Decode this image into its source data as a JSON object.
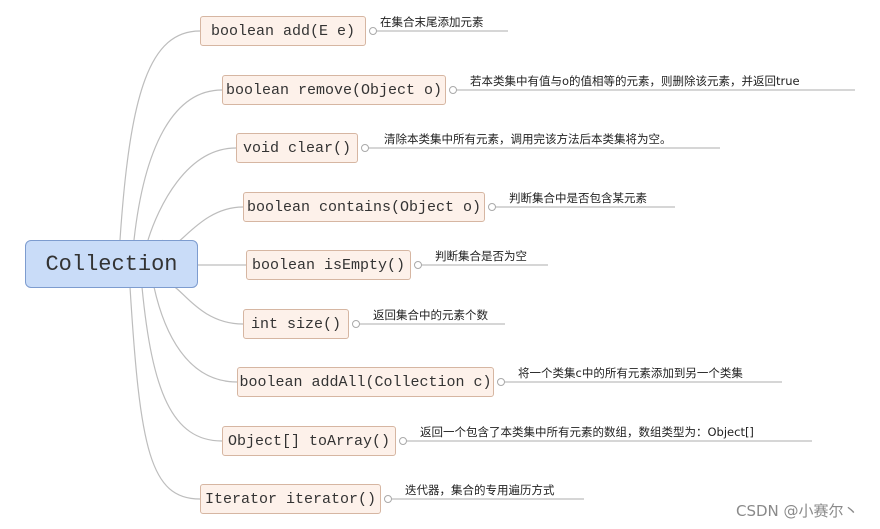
{
  "root": {
    "label": "Collection"
  },
  "methods": [
    {
      "signature": "boolean add(E e)",
      "description": "在集合末尾添加元素"
    },
    {
      "signature": "boolean remove(Object o)",
      "description": "若本类集中有值与o的值相等的元素，则删除该元素，并返回true"
    },
    {
      "signature": "void clear()",
      "description": "清除本类集中所有元素，调用完该方法后本类集将为空。"
    },
    {
      "signature": "boolean contains(Object o)",
      "description": "判断集合中是否包含某元素"
    },
    {
      "signature": "boolean isEmpty()",
      "description": "判断集合是否为空"
    },
    {
      "signature": "int size()",
      "description": "返回集合中的元素个数"
    },
    {
      "signature": "boolean addAll(Collection c)",
      "description": "将一个类集c中的所有元素添加到另一个类集"
    },
    {
      "signature": "Object[] toArray()",
      "description": "返回一个包含了本类集中所有元素的数组，数组类型为：Object[]"
    },
    {
      "signature": "Iterator iterator()",
      "description": "迭代器，集合的专用遍历方式"
    }
  ],
  "watermark": "CSDN @小赛尔丶",
  "colors": {
    "root_fill": "#c9dcf8",
    "root_border": "#7d9ccf",
    "node_fill": "#fdf1ea",
    "node_border": "#d6b6a2",
    "line": "#bdbdbd"
  }
}
